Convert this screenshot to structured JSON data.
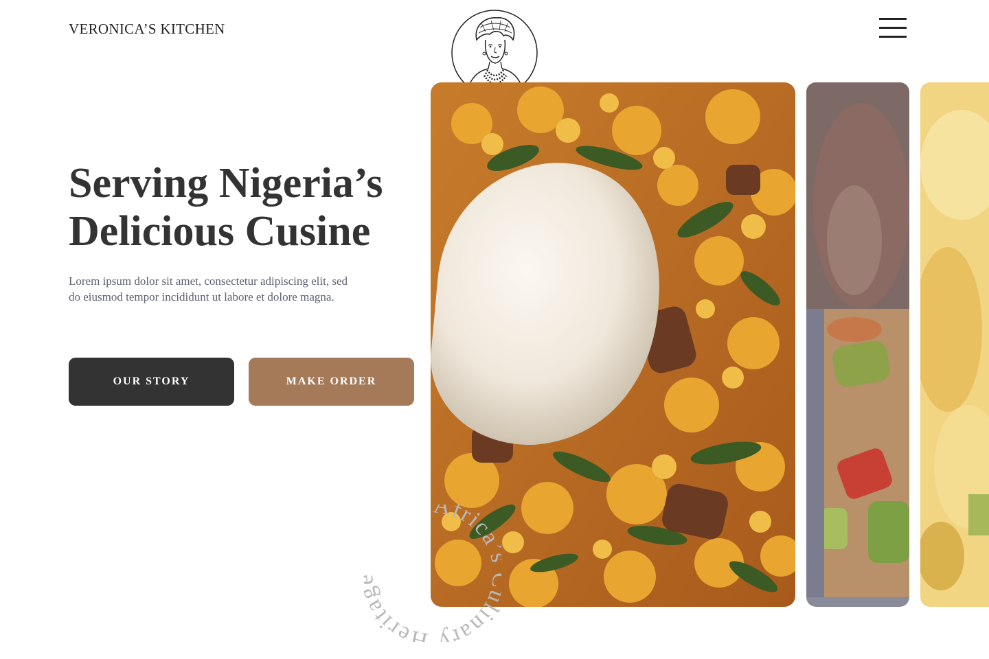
{
  "brand": {
    "name": "VERONICA’S KITCHEN"
  },
  "hero": {
    "title_line1": "Serving Nigeria’s",
    "title_line2": "Delicious Cusine",
    "text_line1": "Lorem ipsum dolor sit amet, consectetur adipiscing elit, sed",
    "text_line2": "do eiusmod tempor incididunt ut labore et dolore magna."
  },
  "buttons": {
    "story": "OUR STORY",
    "order": "MAKE ORDER"
  },
  "badge": {
    "text": "Africa’s Culinary Heritage •"
  },
  "icons": {
    "menu": "hamburger-menu-icon",
    "logo": "woman-portrait-logo"
  },
  "colors": {
    "dark_button": "#333333",
    "accent_button": "#A47A58",
    "text": "#333333",
    "muted_text": "#5c6070",
    "badge_text": "#b8b8b8"
  }
}
